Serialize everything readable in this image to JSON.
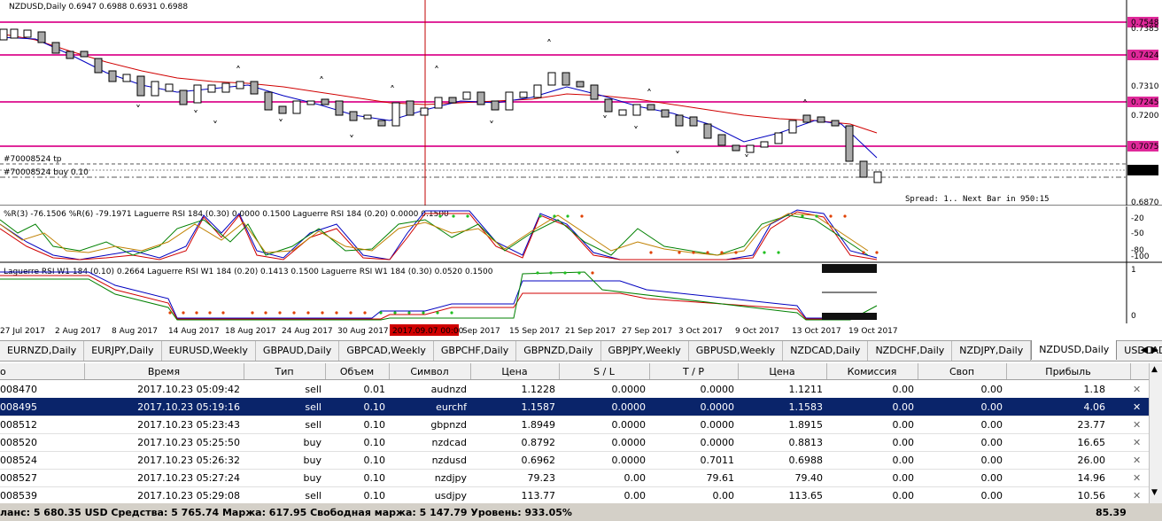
{
  "chart": {
    "symbol_header": "NZDUSD,Daily  0.6947 0.6988 0.6931 0.6988",
    "trade_tp_label": "#70008524 tp",
    "trade_buy_label": "#70008524 buy 0.10",
    "spread_label": "Spread: 1.. Next Bar in 950:15",
    "level_labels": [
      "0.7548",
      "0.7424",
      "0.7245",
      "0.7075"
    ],
    "current_price": "0.6988",
    "axis_labels": [
      "0.7385",
      "0.7310",
      "0.7200",
      "0.6870"
    ],
    "ind1_header": "%R(3) -76.1506  %R(6) -79.1971  Laguerre RSI 184 (0.30) 0.0000 0.1500  Laguerre RSI 184 (0.20) 0.0000 0.1500",
    "ind1_axis": [
      "-20",
      "-50",
      "-80",
      "-100"
    ],
    "ind2_header": "Laguerre RSI W1 184 (0.10) 0.2664  Laguerre RSI W1 184 (0.20) 0.1413 0.1500  Laguerre RSI W1 184 (0.30) 0.0520 0.1500",
    "ind2_axis": [
      "1",
      "0"
    ],
    "date_labels": [
      "27 Jul 2017",
      "2 Aug 2017",
      "8 Aug 2017",
      "14 Aug 2017",
      "18 Aug 2017",
      "24 Aug 2017",
      "30 Aug 2017",
      "Sep 2017",
      "15 Sep 2017",
      "21 Sep 2017",
      "27 Sep 2017",
      "3 Oct 2017",
      "9 Oct 2017",
      "13 Oct 2017",
      "19 Oct 2017"
    ],
    "cursor_date": "2017.09.07 00:00",
    "colors": {
      "levels": "#e0299a",
      "ma_red": "#d00000",
      "ma_blue": "#0000c0",
      "cursor": "#c00000"
    }
  },
  "tabs": [
    "EURNZD,Daily",
    "EURJPY,Daily",
    "EURUSD,Weekly",
    "GBPAUD,Daily",
    "GBPCAD,Weekly",
    "GBPCHF,Daily",
    "GBPNZD,Daily",
    "GBPJPY,Weekly",
    "GBPUSD,Weekly",
    "NZDCAD,Daily",
    "NZDCHF,Daily",
    "NZDJPY,Daily",
    "NZDUSD,Daily",
    "USDCAD,Daily"
  ],
  "active_tab": "NZDUSD,Daily",
  "table": {
    "headers": [
      "о",
      "Время",
      "Тип",
      "Объем",
      "Символ",
      "Цена",
      "S / L",
      "T / P",
      "Цена",
      "Комиссия",
      "Своп",
      "Прибыль"
    ],
    "rows": [
      [
        "008470",
        "2017.10.23 05:09:42",
        "sell",
        "0.01",
        "audnzd",
        "1.1228",
        "0.0000",
        "0.0000",
        "1.1211",
        "0.00",
        "0.00",
        "1.18"
      ],
      [
        "008495",
        "2017.10.23 05:19:16",
        "sell",
        "0.10",
        "eurchf",
        "1.1587",
        "0.0000",
        "0.0000",
        "1.1583",
        "0.00",
        "0.00",
        "4.06"
      ],
      [
        "008512",
        "2017.10.23 05:23:43",
        "sell",
        "0.10",
        "gbpnzd",
        "1.8949",
        "0.0000",
        "0.0000",
        "1.8915",
        "0.00",
        "0.00",
        "23.77"
      ],
      [
        "008520",
        "2017.10.23 05:25:50",
        "buy",
        "0.10",
        "nzdcad",
        "0.8792",
        "0.0000",
        "0.0000",
        "0.8813",
        "0.00",
        "0.00",
        "16.65"
      ],
      [
        "008524",
        "2017.10.23 05:26:32",
        "buy",
        "0.10",
        "nzdusd",
        "0.6962",
        "0.0000",
        "0.7011",
        "0.6988",
        "0.00",
        "0.00",
        "26.00"
      ],
      [
        "008527",
        "2017.10.23 05:27:24",
        "buy",
        "0.10",
        "nzdjpy",
        "79.23",
        "0.00",
        "79.61",
        "79.40",
        "0.00",
        "0.00",
        "14.96"
      ],
      [
        "008539",
        "2017.10.23 05:29:08",
        "sell",
        "0.10",
        "usdjpy",
        "113.77",
        "0.00",
        "0.00",
        "113.65",
        "0.00",
        "0.00",
        "10.56"
      ]
    ],
    "selected_row": 1
  },
  "status": {
    "summary": "ланс: 5 680.35 USD  Средства: 5 765.74  Маржа: 617.95  Свободная маржа: 5 147.79  Уровень: 933.05%",
    "total_profit": "85.39"
  }
}
